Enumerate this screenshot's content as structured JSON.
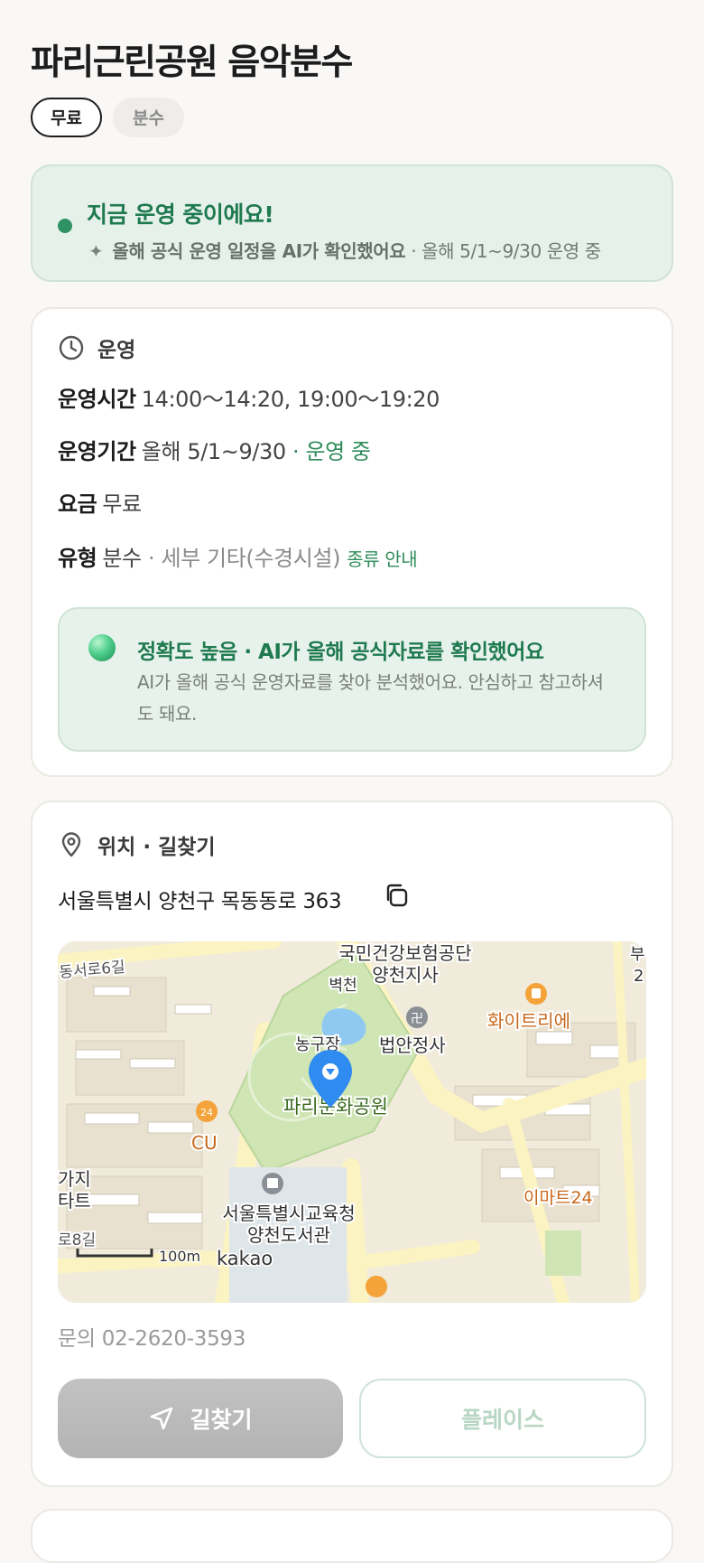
{
  "place": {
    "title": "파리근린공원 음악분수"
  },
  "tags": [
    {
      "label": "무료"
    },
    {
      "label": "분수"
    }
  ],
  "status": {
    "title": "지금 운영 중이에요!",
    "ai_note": "올해 공식 운영 일정을 AI가 확인했어요",
    "period_note": "· 올해 5/1~9/30 운영 중",
    "color": "#2e9263"
  },
  "operation": {
    "section_label": "운영",
    "hours_label": "운영시간",
    "hours_value": "14:00～14:20, 19:00～19:20",
    "period_label": "운영기간",
    "period_value": "올해 5/1~9/30",
    "period_status": "· 운영 중",
    "fee_label": "요금",
    "fee_value": "무료",
    "type_label": "유형",
    "type_value": "분수",
    "type_detail": "· 세부 기타(수경시설)",
    "type_guide": "종류 안내",
    "accuracy_title": "정확도 높음 · AI가 올해 공식자료를 확인했어요",
    "accuracy_desc": "AI가 올해 공식 운영자료를 찾아 분석했어요. 안심하고 참고하셔도 돼요."
  },
  "location": {
    "section_label": "위치 · 길찾기",
    "address": "서울특별시 양천구 목동동로 363",
    "map": {
      "labels": {
        "nhis": "국민건강보험공단",
        "nhis_branch": "양천지사",
        "byeokcheon": "벽천",
        "basketball": "농구장",
        "temple": "법안정사",
        "park": "파리문화공원",
        "whitree": "화이트리에",
        "cu": "CU",
        "office_line1": "서울특별시교육청",
        "office_line2": "양천도서관",
        "emart": "이마트24",
        "road_top": "동서로6길",
        "road_bottom": "로8길",
        "left_bldg1": "가지",
        "left_bldg2": "타트",
        "corner_top": "부",
        "corner_top2": "2",
        "scale": "100m",
        "brand": "kakao"
      }
    },
    "inquiry": "문의 02-2620-3593",
    "route_button": "길찾기",
    "place_button": "플레이스"
  }
}
